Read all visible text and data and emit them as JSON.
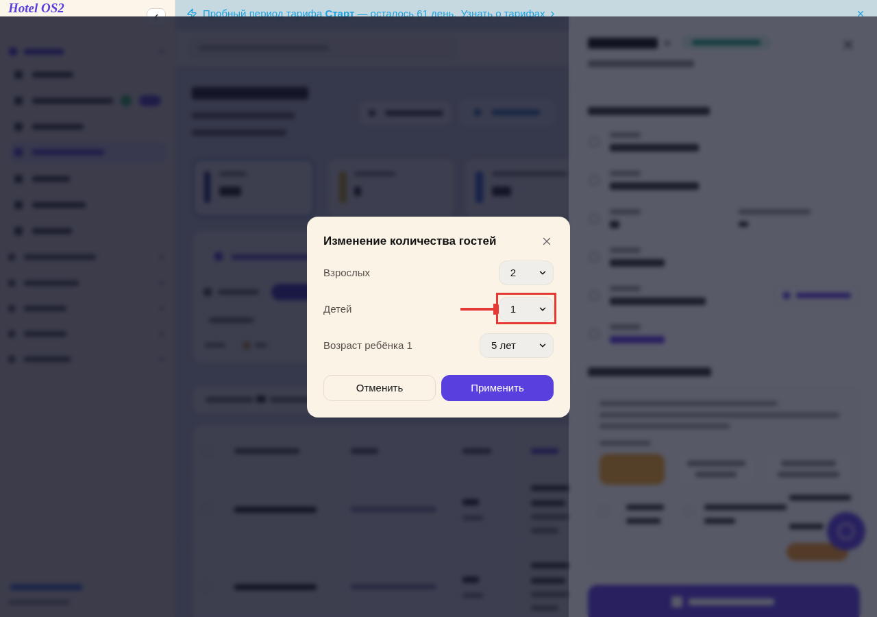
{
  "banner": {
    "message": "Пробный период тарифа **Старт** — осталось 61 день.",
    "link": "Узнать о тарифах"
  },
  "sidebar": {
    "logo": "Hotel OS2"
  },
  "dialog": {
    "title": "Изменение количества гостей",
    "fields": [
      {
        "label": "Взрослых",
        "value": "2",
        "highlighted": false
      },
      {
        "label": "Детей",
        "value": "1",
        "highlighted": true
      },
      {
        "label": "Возраст ребёнка 1",
        "value": "5 лет",
        "highlighted": false
      }
    ],
    "buttons": [
      {
        "label": "Отменить",
        "kind": "secondary"
      },
      {
        "label": "Применить",
        "kind": "primary"
      }
    ]
  }
}
